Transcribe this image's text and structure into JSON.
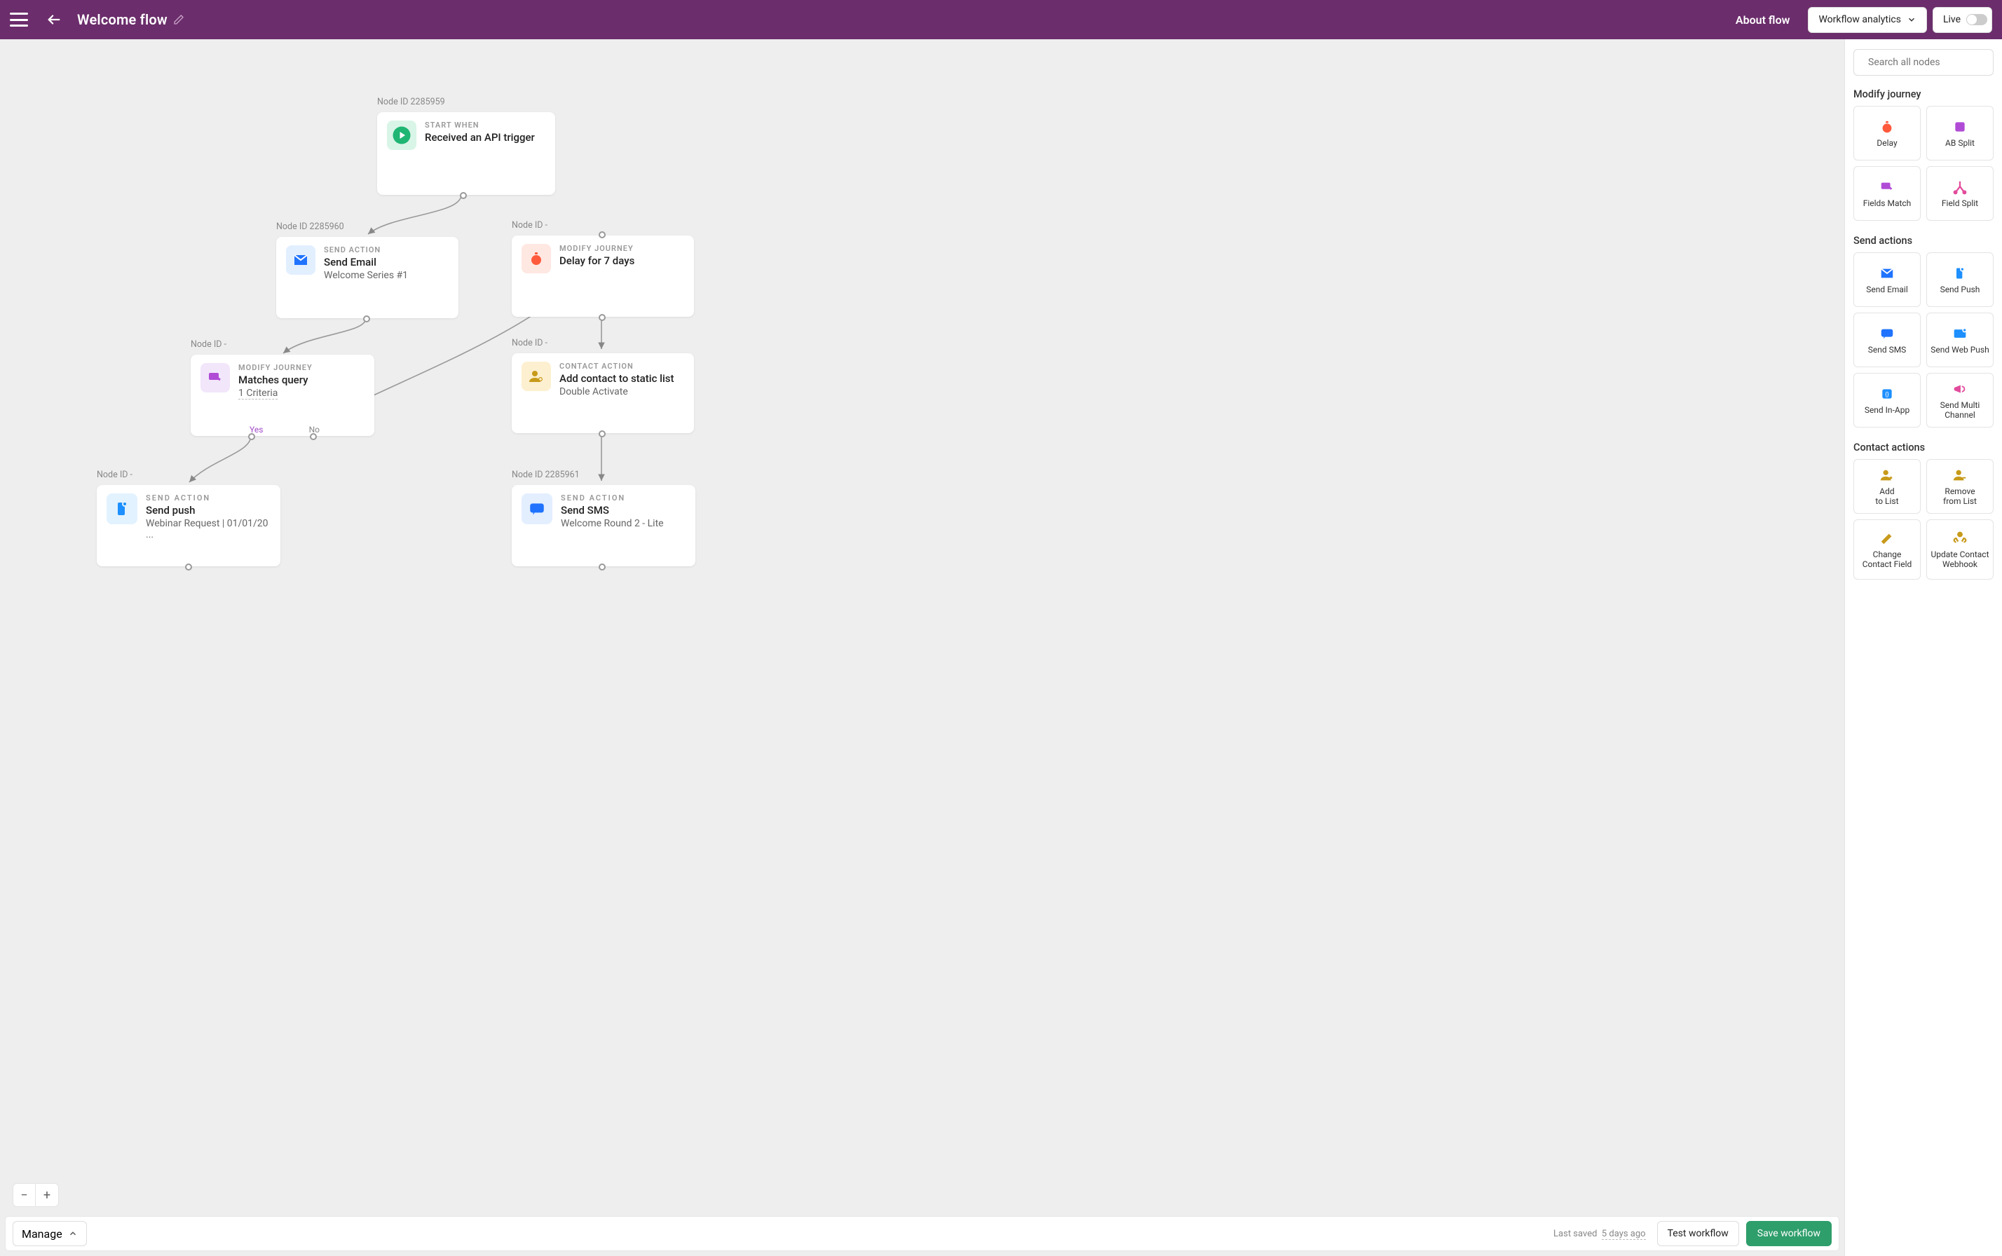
{
  "header": {
    "title": "Welcome flow",
    "about": "About flow",
    "analytics": "Workflow analytics",
    "live": "Live"
  },
  "search": {
    "placeholder": "Search all nodes"
  },
  "panel": {
    "modify_head": "Modify journey",
    "send_head": "Send actions",
    "contact_head": "Contact actions",
    "modify": {
      "delay": "Delay",
      "absplit": "AB Split",
      "fieldsmatch": "Fields Match",
      "fieldsplit": "Field Split"
    },
    "send": {
      "email": "Send Email",
      "push": "Send Push",
      "sms": "Send SMS",
      "webpush": "Send Web Push",
      "inapp": "Send In-App",
      "multi1": "Send Multi",
      "multi2": "Channel"
    },
    "contact": {
      "add1": "Add",
      "add2": "to List",
      "remove1": "Remove",
      "remove2": "from List",
      "change1": "Change",
      "change2": "Contact Field",
      "webhook1": "Update Contact",
      "webhook2": "Webhook"
    }
  },
  "nodes": {
    "start": {
      "id": "Node ID 2285959",
      "cat": "START WHEN",
      "title": "Received an API trigger"
    },
    "email": {
      "id": "Node ID 2285960",
      "cat": "SEND ACTION",
      "title": "Send Email",
      "sub": "Welcome Series #1"
    },
    "delay": {
      "id": "Node ID -",
      "cat": "MODIFY JOURNEY",
      "title": "Delay for 7 days"
    },
    "match": {
      "id": "Node ID -",
      "cat": "MODIFY JOURNEY",
      "title": "Matches query",
      "sub": "1 Criteria",
      "yes": "Yes",
      "no": "No"
    },
    "addlist": {
      "id": "Node ID -",
      "cat": "CONTACT ACTION",
      "title": "Add contact to static list",
      "sub": "Double Activate"
    },
    "push": {
      "id": "Node ID -",
      "cat": "SEND ACTION",
      "title": "Send push",
      "sub": "Webinar Request | 01/01/20 ..."
    },
    "sms": {
      "id": "Node ID 2285961",
      "cat": "SEND ACTION",
      "title": "Send SMS",
      "sub": "Welcome Round 2 - Lite"
    }
  },
  "bottom": {
    "manage": "Manage",
    "saved_label": "Last saved",
    "saved_ago": "5 days ago",
    "test": "Test workflow",
    "save": "Save workflow"
  }
}
